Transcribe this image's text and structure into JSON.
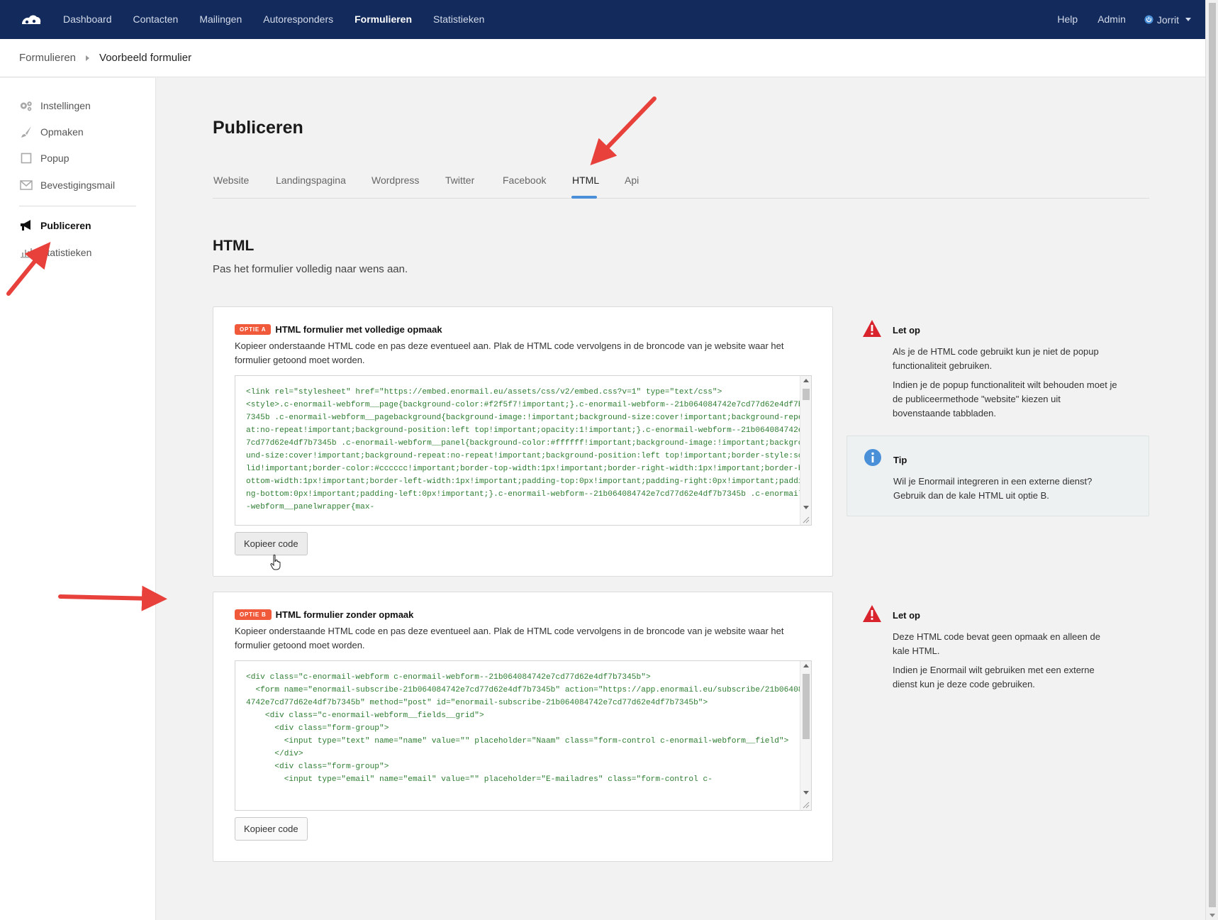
{
  "nav": {
    "items": [
      {
        "label": "Dashboard",
        "active": false
      },
      {
        "label": "Contacten",
        "active": false
      },
      {
        "label": "Mailingen",
        "active": false
      },
      {
        "label": "Autoresponders",
        "active": false
      },
      {
        "label": "Formulieren",
        "active": true
      },
      {
        "label": "Statistieken",
        "active": false
      }
    ],
    "right": {
      "help": "Help",
      "admin": "Admin",
      "user": "Jorrit"
    }
  },
  "breadcrumb": {
    "parent": "Formulieren",
    "current": "Voorbeeld formulier"
  },
  "sidebar": {
    "items": [
      {
        "label": "Instellingen",
        "icon": "gears-icon"
      },
      {
        "label": "Opmaken",
        "icon": "brush-icon"
      },
      {
        "label": "Popup",
        "icon": "square-icon"
      },
      {
        "label": "Bevestigingsmail",
        "icon": "envelope-icon"
      },
      {
        "label": "Publiceren",
        "icon": "megaphone-icon",
        "active": true
      },
      {
        "label": "Statistieken",
        "icon": "bar-chart-icon"
      }
    ]
  },
  "main": {
    "title": "Publiceren",
    "tabs": [
      {
        "label": "Website"
      },
      {
        "label": "Landingspagina"
      },
      {
        "label": "Wordpress"
      },
      {
        "label": "Twitter"
      },
      {
        "label": "Facebook"
      },
      {
        "label": "HTML",
        "active": true
      },
      {
        "label": "Api"
      }
    ],
    "section_title": "HTML",
    "section_subtitle": "Pas het formulier volledig naar wens aan."
  },
  "option_a": {
    "badge": "OPTIE A",
    "title": "HTML formulier met volledige opmaak",
    "description": "Kopieer onderstaande HTML code en pas deze eventueel aan. Plak de HTML code vervolgens in de broncode van je website waar het formulier getoond moet worden.",
    "code": "<link rel=\"stylesheet\" href=\"https://embed.enormail.eu/assets/css/v2/embed.css?v=1\" type=\"text/css\">\n<style>.c-enormail-webform__page{background-color:#f2f5f7!important;}.c-enormail-webform--21b064084742e7cd77d62e4df7b7345b .c-enormail-webform__pagebackground{background-image:!important;background-size:cover!important;background-repeat:no-repeat!important;background-position:left top!important;opacity:1!important;}.c-enormail-webform--21b064084742e7cd77d62e4df7b7345b .c-enormail-webform__panel{background-color:#ffffff!important;background-image:!important;background-size:cover!important;background-repeat:no-repeat!important;background-position:left top!important;border-style:solid!important;border-color:#cccccc!important;border-top-width:1px!important;border-right-width:1px!important;border-bottom-width:1px!important;border-left-width:1px!important;padding-top:0px!important;padding-right:0px!important;padding-bottom:0px!important;padding-left:0px!important;}.c-enormail-webform--21b064084742e7cd77d62e4df7b7345b .c-enormail-webform__panelwrapper{max-",
    "copy_button": "Kopieer code"
  },
  "option_b": {
    "badge": "OPTIE B",
    "title": "HTML formulier zonder opmaak",
    "description": "Kopieer onderstaande HTML code en pas deze eventueel aan. Plak de HTML code vervolgens in de broncode van je website waar het formulier getoond moet worden.",
    "code": "<div class=\"c-enormail-webform c-enormail-webform--21b064084742e7cd77d62e4df7b7345b\">\n  <form name=\"enormail-subscribe-21b064084742e7cd77d62e4df7b7345b\" action=\"https://app.enormail.eu/subscribe/21b064084742e7cd77d62e4df7b7345b\" method=\"post\" id=\"enormail-subscribe-21b064084742e7cd77d62e4df7b7345b\">\n    <div class=\"c-enormail-webform__fields__grid\">\n      <div class=\"form-group\">\n        <input type=\"text\" name=\"name\" value=\"\" placeholder=\"Naam\" class=\"form-control c-enormail-webform__field\">\n      </div>\n      <div class=\"form-group\">\n        <input type=\"email\" name=\"email\" value=\"\" placeholder=\"E-mailadres\" class=\"form-control c-",
    "copy_button": "Kopieer code"
  },
  "notes": {
    "note_a": {
      "title": "Let op",
      "paragraphs": [
        "Als je de HTML code gebruikt kun je niet de popup functionaliteit gebruiken.",
        "Indien je de popup functionaliteit wilt behouden moet je de publiceermethode \"website\" kiezen uit bovenstaande tabbladen."
      ]
    },
    "tip": {
      "title": "Tip",
      "paragraphs": [
        "Wil je Enormail integreren in een externe dienst? Gebruik dan de kale HTML uit optie B."
      ]
    },
    "note_b": {
      "title": "Let op",
      "paragraphs": [
        "Deze HTML code bevat geen opmaak en alleen de kale HTML.",
        "Indien je Enormail wilt gebruiken met een externe dienst kun je deze code gebruiken."
      ]
    }
  },
  "colors": {
    "navbar": "#122a5c",
    "accent": "#4a90d9",
    "badge": "#f05a3a",
    "warning": "#d9232d",
    "info": "#4a90d9",
    "code": "#2e7d32",
    "annotation_arrow": "#e8413b"
  }
}
